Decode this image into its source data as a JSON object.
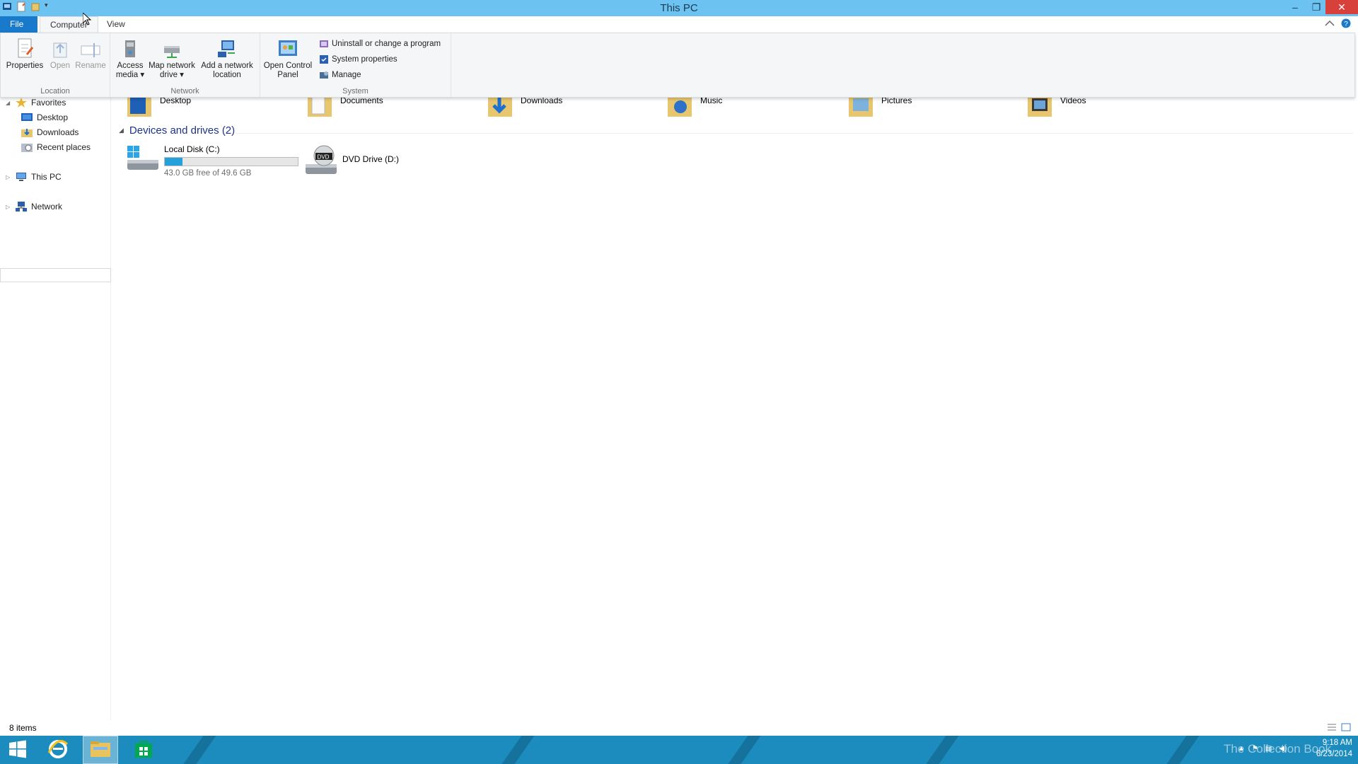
{
  "window": {
    "title": "This PC"
  },
  "window_controls": {
    "minimize": "–",
    "restore": "❐",
    "close": "✕"
  },
  "ribbon_tabs": {
    "file": "File",
    "computer": "Computer",
    "view": "View"
  },
  "ribbon": {
    "location": {
      "label": "Location",
      "properties": "Properties",
      "open": "Open",
      "rename": "Rename"
    },
    "network": {
      "label": "Network",
      "access_media_1": "Access",
      "access_media_2": "media ▾",
      "map_drive_1": "Map network",
      "map_drive_2": "drive ▾",
      "add_location_1": "Add a network",
      "add_location_2": "location"
    },
    "system": {
      "label": "System",
      "control_panel_1": "Open Control",
      "control_panel_2": "Panel",
      "uninstall": "Uninstall or change a program",
      "system_properties": "System properties",
      "manage": "Manage"
    }
  },
  "nav": {
    "favorites": "Favorites",
    "desktop": "Desktop",
    "downloads": "Downloads",
    "recent": "Recent places",
    "this_pc": "This PC",
    "network": "Network"
  },
  "folders": [
    {
      "name": "Desktop",
      "icon": "desktop-folder-icon"
    },
    {
      "name": "Documents",
      "icon": "documents-folder-icon"
    },
    {
      "name": "Downloads",
      "icon": "downloads-folder-icon"
    },
    {
      "name": "Music",
      "icon": "music-folder-icon"
    },
    {
      "name": "Pictures",
      "icon": "pictures-folder-icon"
    },
    {
      "name": "Videos",
      "icon": "videos-folder-icon"
    }
  ],
  "devices": {
    "header": "Devices and drives (2)",
    "local_disk": {
      "name": "Local Disk (C:)",
      "free": "43.0 GB free of 49.6 GB",
      "used_fraction": 0.133
    },
    "dvd": {
      "name": "DVD Drive (D:)",
      "badge": "DVD"
    }
  },
  "status": {
    "count": "8 items"
  },
  "taskbar": {
    "watermark": "The Collection Book",
    "time": "9:18 AM",
    "date": "6/23/2014"
  },
  "colors": {
    "accent": "#1979ca",
    "titlebar": "#6cc2f0",
    "taskbar": "#1c8bbd",
    "progress": "#26a0da"
  }
}
